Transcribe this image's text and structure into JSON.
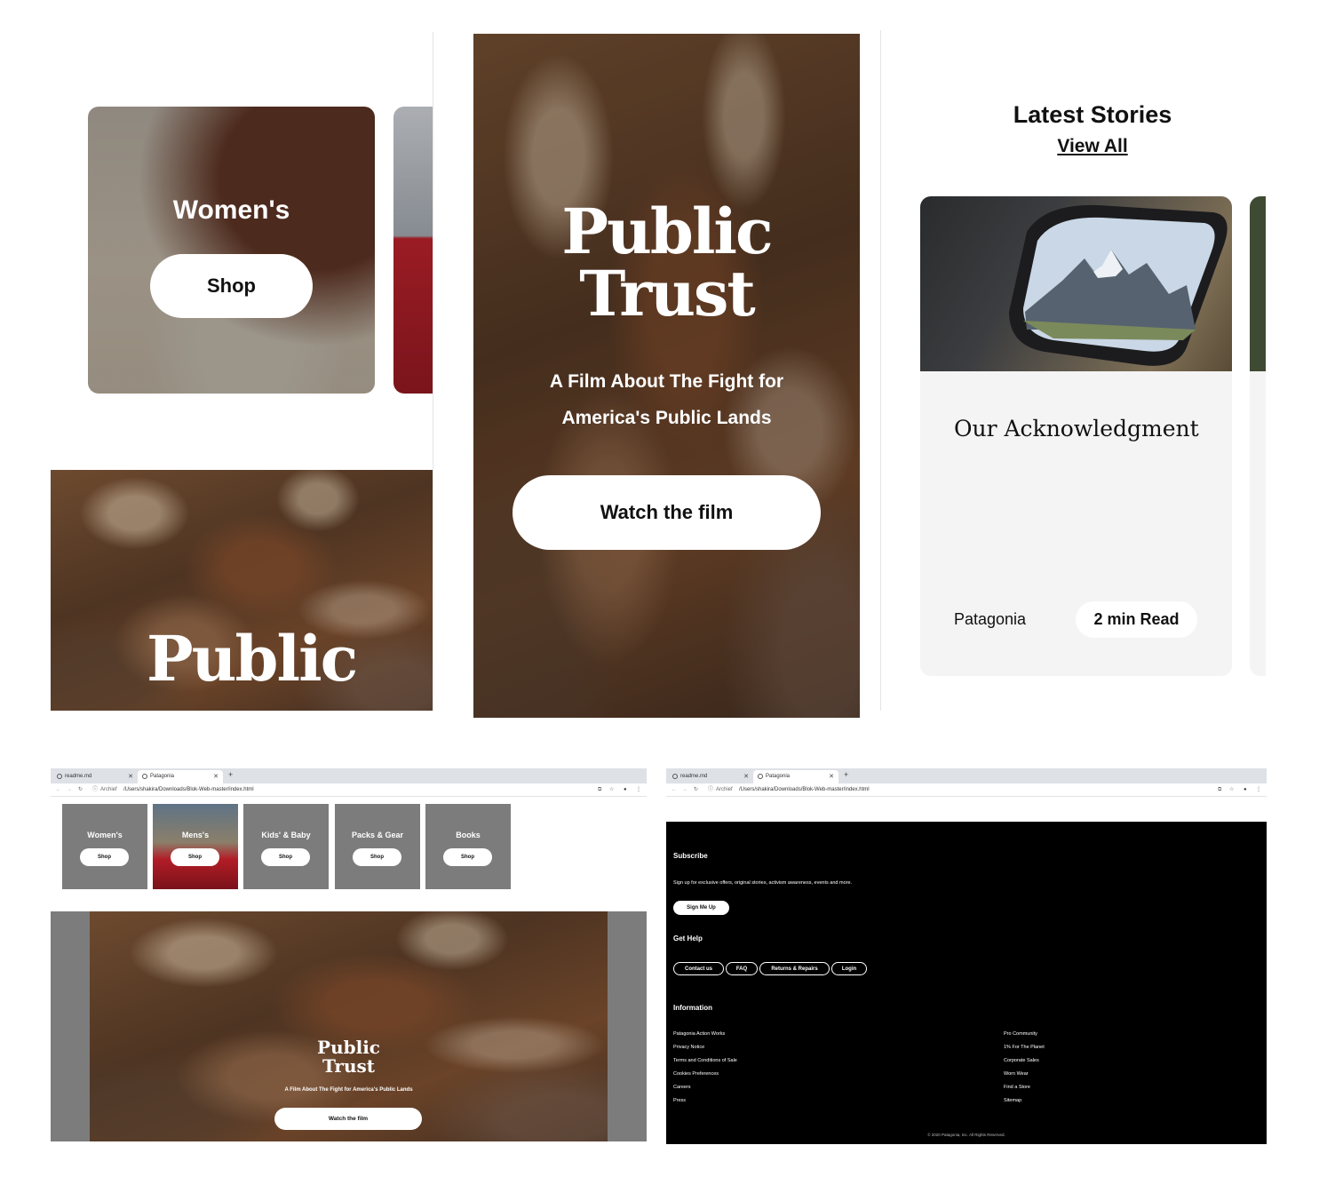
{
  "panel1": {
    "category_label": "Women's",
    "shop_label": "Shop",
    "hero_title_line1": "Public"
  },
  "panel2": {
    "hero_title_line1": "Public",
    "hero_title_line2": "Trust",
    "subtitle_line1": "A Film About The Fight for",
    "subtitle_line2": "America's Public Lands",
    "cta": "Watch the film"
  },
  "panel3": {
    "heading": "Latest Stories",
    "view_all": "View All",
    "story_title": "Our Acknowledgment",
    "story_author": "Patagonia",
    "story_read_time": "2 min Read"
  },
  "browser": {
    "tabs": [
      "readme.md",
      "Patagonia"
    ],
    "new_tab": "+",
    "url_prefix": "Archief",
    "url": "/Users/shakira/Downloads/Blok-Web-master/index.html"
  },
  "panel4": {
    "categories": [
      {
        "label": "Women's",
        "shop": "Shop"
      },
      {
        "label": "Mens's",
        "shop": "Shop"
      },
      {
        "label": "Kids' & Baby",
        "shop": "Shop"
      },
      {
        "label": "Packs & Gear",
        "shop": "Shop"
      },
      {
        "label": "Books",
        "shop": "Shop"
      }
    ],
    "hero_title_line1": "Public",
    "hero_title_line2": "Trust",
    "hero_subtitle": "A Film About The Fight for America's Public Lands",
    "hero_cta": "Watch the film"
  },
  "panel5": {
    "subscribe_heading": "Subscribe",
    "subscribe_text": "Sign up for exclusive offers, original stories, activism awareness, events and more.",
    "subscribe_button": "Sign Me Up",
    "help_heading": "Get Help",
    "help_buttons": [
      "Contact us",
      "FAQ",
      "Returns & Repairs",
      "Login"
    ],
    "info_heading": "Information",
    "info_left": [
      "Patagonia Action Works",
      "Privacy Notice",
      "Terms and Conditions of Sale",
      "Cookies Preferences",
      "Careers",
      "Press"
    ],
    "info_right": [
      "Pro Community",
      "1% For The Planet",
      "Corporate Sales",
      "Worn Wear",
      "Find a Store",
      "Sitemap"
    ],
    "copyright": "© 2020 Patagonia, Inc. All Rights Reserved."
  }
}
